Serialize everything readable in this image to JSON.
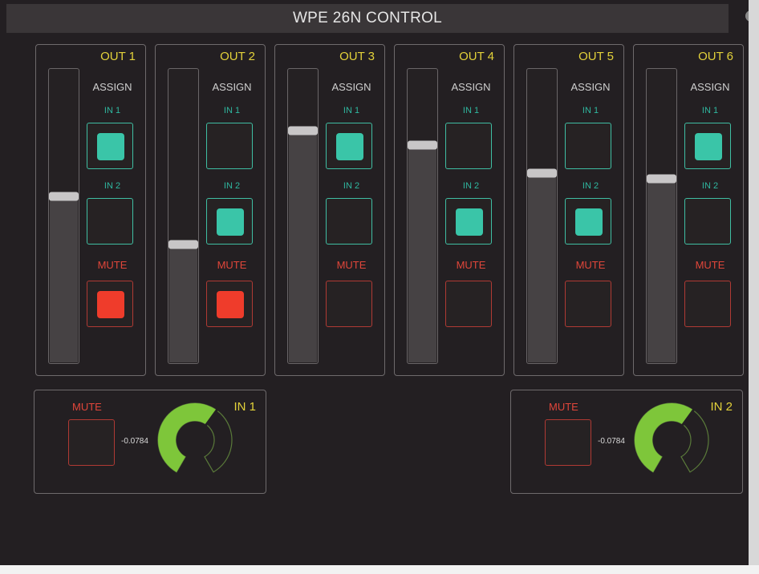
{
  "window": {
    "title": "WPE 26N CONTROL",
    "info_icon": "info-icon"
  },
  "outputs": [
    {
      "label": "OUT 1",
      "assign_label": "ASSIGN",
      "in1_label": "IN 1",
      "in2_label": "IN 2",
      "mute_label": "MUTE",
      "in1_on": true,
      "in2_on": false,
      "mute_on": true,
      "fader_level": 0.57
    },
    {
      "label": "OUT 2",
      "assign_label": "ASSIGN",
      "in1_label": "IN 1",
      "in2_label": "IN 2",
      "mute_label": "MUTE",
      "in1_on": false,
      "in2_on": true,
      "mute_on": true,
      "fader_level": 0.4
    },
    {
      "label": "OUT 3",
      "assign_label": "ASSIGN",
      "in1_label": "IN 1",
      "in2_label": "IN 2",
      "mute_label": "MUTE",
      "in1_on": true,
      "in2_on": false,
      "mute_on": false,
      "fader_level": 0.8
    },
    {
      "label": "OUT 4",
      "assign_label": "ASSIGN",
      "in1_label": "IN 1",
      "in2_label": "IN 2",
      "mute_label": "MUTE",
      "in1_on": false,
      "in2_on": true,
      "mute_on": false,
      "fader_level": 0.75
    },
    {
      "label": "OUT 5",
      "assign_label": "ASSIGN",
      "in1_label": "IN 1",
      "in2_label": "IN 2",
      "mute_label": "MUTE",
      "in1_on": false,
      "in2_on": true,
      "mute_on": false,
      "fader_level": 0.65
    },
    {
      "label": "OUT 6",
      "assign_label": "ASSIGN",
      "in1_label": "IN 1",
      "in2_label": "IN 2",
      "mute_label": "MUTE",
      "in1_on": true,
      "in2_on": false,
      "mute_on": false,
      "fader_level": 0.63
    }
  ],
  "inputs": [
    {
      "label": "IN 1",
      "mute_label": "MUTE",
      "mute_on": false,
      "gain_text": "-0.0784",
      "gain_level": 0.62
    },
    {
      "label": "IN 2",
      "mute_label": "MUTE",
      "mute_on": false,
      "gain_text": "-0.0784",
      "gain_level": 0.62
    }
  ],
  "colors": {
    "background": "#231f22",
    "title_bar": "#3a3638",
    "out_label": "#e3d23a",
    "assign_active": "#3ac5a8",
    "mute_active": "#ef3c2b",
    "knob_arc": "#7ec63a"
  }
}
